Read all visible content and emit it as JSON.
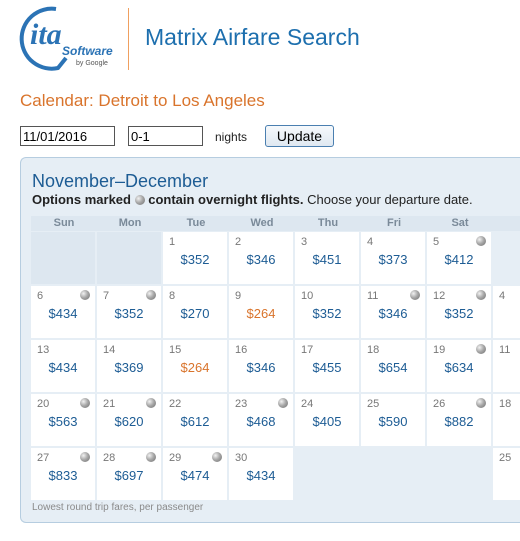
{
  "brand": {
    "logo_text": "ita",
    "logo_subtext": "Software",
    "logo_tagline": "by Google"
  },
  "header": {
    "app_title": "Matrix Airfare Search"
  },
  "page_title": "Calendar: Detroit to Los Angeles",
  "controls": {
    "date_value": "11/01/2016",
    "range_value": "0-1",
    "nights_label": "nights",
    "update_label": "Update"
  },
  "calendar": {
    "heading": "November–December",
    "note_bold_start": "Options marked",
    "note_bold_end": "contain overnight flights.",
    "note_rest": "Choose your departure date.",
    "weekdays": [
      "Sun",
      "Mon",
      "Tue",
      "Wed",
      "Thu",
      "Fri",
      "Sat"
    ],
    "footnote": "Lowest round trip fares, per passenger",
    "colors": {
      "price": "#1d5c94",
      "lowest_price": "#d9742c",
      "panel": "#e6eef5"
    },
    "days": [
      {
        "day": "1",
        "price": "$352",
        "overnight": false,
        "lowest": false
      },
      {
        "day": "2",
        "price": "$346",
        "overnight": false,
        "lowest": false
      },
      {
        "day": "3",
        "price": "$451",
        "overnight": false,
        "lowest": false
      },
      {
        "day": "4",
        "price": "$373",
        "overnight": false,
        "lowest": false
      },
      {
        "day": "5",
        "price": "$412",
        "overnight": true,
        "lowest": false
      },
      {
        "day": "6",
        "price": "$434",
        "overnight": true,
        "lowest": false
      },
      {
        "day": "7",
        "price": "$352",
        "overnight": true,
        "lowest": false
      },
      {
        "day": "8",
        "price": "$270",
        "overnight": false,
        "lowest": false
      },
      {
        "day": "9",
        "price": "$264",
        "overnight": false,
        "lowest": true
      },
      {
        "day": "10",
        "price": "$352",
        "overnight": false,
        "lowest": false
      },
      {
        "day": "11",
        "price": "$346",
        "overnight": true,
        "lowest": false
      },
      {
        "day": "12",
        "price": "$352",
        "overnight": true,
        "lowest": false
      },
      {
        "day": "13",
        "price": "$434",
        "overnight": false,
        "lowest": false
      },
      {
        "day": "14",
        "price": "$369",
        "overnight": false,
        "lowest": false
      },
      {
        "day": "15",
        "price": "$264",
        "overnight": false,
        "lowest": true
      },
      {
        "day": "16",
        "price": "$346",
        "overnight": false,
        "lowest": false
      },
      {
        "day": "17",
        "price": "$455",
        "overnight": false,
        "lowest": false
      },
      {
        "day": "18",
        "price": "$654",
        "overnight": false,
        "lowest": false
      },
      {
        "day": "19",
        "price": "$634",
        "overnight": true,
        "lowest": false
      },
      {
        "day": "20",
        "price": "$563",
        "overnight": true,
        "lowest": false
      },
      {
        "day": "21",
        "price": "$620",
        "overnight": true,
        "lowest": false
      },
      {
        "day": "22",
        "price": "$612",
        "overnight": false,
        "lowest": false
      },
      {
        "day": "23",
        "price": "$468",
        "overnight": true,
        "lowest": false
      },
      {
        "day": "24",
        "price": "$405",
        "overnight": false,
        "lowest": false
      },
      {
        "day": "25",
        "price": "$590",
        "overnight": false,
        "lowest": false
      },
      {
        "day": "26",
        "price": "$882",
        "overnight": true,
        "lowest": false
      },
      {
        "day": "27",
        "price": "$833",
        "overnight": true,
        "lowest": false
      },
      {
        "day": "28",
        "price": "$697",
        "overnight": true,
        "lowest": false
      },
      {
        "day": "29",
        "price": "$474",
        "overnight": true,
        "lowest": false
      },
      {
        "day": "30",
        "price": "$434",
        "overnight": false,
        "lowest": false
      }
    ],
    "next_month_days": [
      "4",
      "11",
      "18",
      "25"
    ]
  }
}
